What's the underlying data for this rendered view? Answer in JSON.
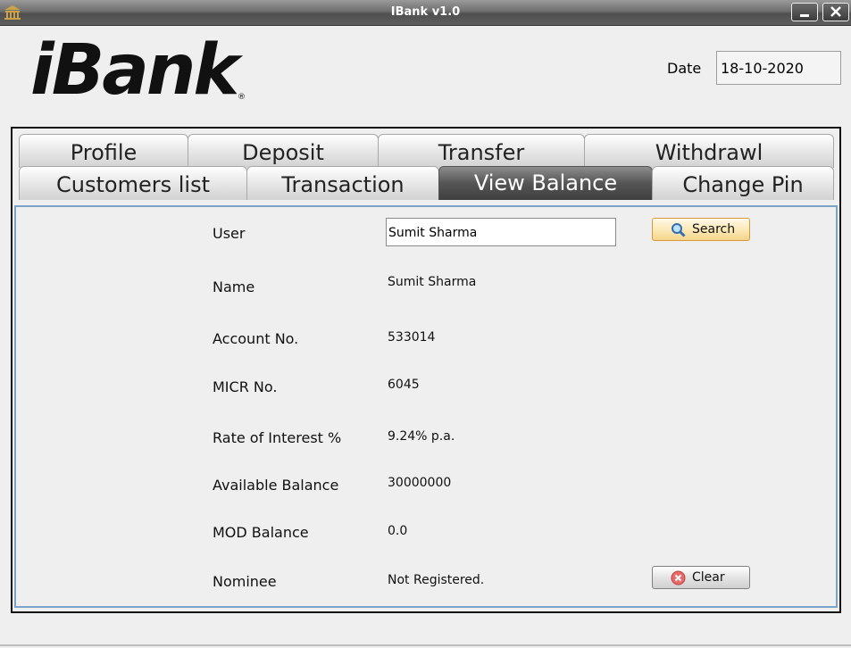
{
  "window": {
    "title": "IBank v1.0",
    "app_icon": "bank-icon"
  },
  "logo": {
    "text": "iBank",
    "reg_mark": "®"
  },
  "header": {
    "date_label": "Date",
    "date_value": "18-10-2020"
  },
  "tabs": {
    "row1": [
      "Profile",
      "Deposit",
      "Transfer",
      "Withdrawl"
    ],
    "row2": [
      "Customers list",
      "Transaction",
      "View Balance",
      "Change Pin"
    ],
    "active": "View Balance"
  },
  "form": {
    "user_label": "User",
    "user_value": "Sumit Sharma",
    "search_label": "Search",
    "fields": [
      {
        "label": "Name",
        "value": "Sumit Sharma"
      },
      {
        "label": "Account No.",
        "value": "533014"
      },
      {
        "label": "MICR No.",
        "value": "6045"
      },
      {
        "label": "Rate of Interest %",
        "value": "9.24% p.a."
      },
      {
        "label": "Available Balance",
        "value": "30000000"
      },
      {
        "label": "MOD Balance",
        "value": "0.0"
      },
      {
        "label": "Nominee",
        "value": "Not Registered."
      }
    ],
    "clear_label": "Clear"
  },
  "colors": {
    "accent_border": "#7aa3c8",
    "search_button": "#fde9b8",
    "clear_icon": "#e86a6a"
  }
}
